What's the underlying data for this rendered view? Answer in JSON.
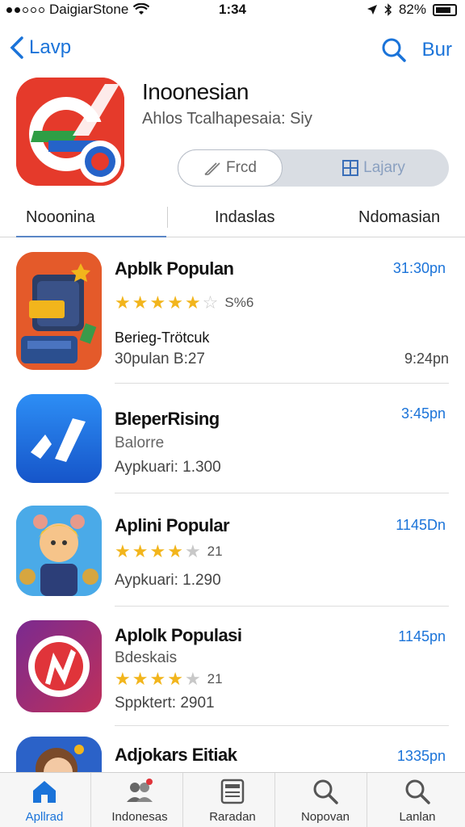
{
  "status": {
    "carrier": "DaigiarStone",
    "time": "1:34",
    "battery": "82%"
  },
  "nav": {
    "back_label": "Lavp",
    "buy_label": "Bur"
  },
  "app": {
    "title": "Inoonesian",
    "subtitle": "Ahlos Tcalhapesaia: Siy",
    "segment": {
      "option1": "Frcd",
      "option2": "Lajary"
    },
    "brand_color": "#e53a2b"
  },
  "tabs": [
    "Nooonina",
    "Indaslas",
    "Ndomasian"
  ],
  "list": [
    {
      "name": "Apblk Populan",
      "time": "31:30pn",
      "rating": 4.5,
      "rating_count": "S%6",
      "line1": "Berieg-Trötcuk",
      "line2": "30pulan B:27",
      "time2": "9:24pn"
    },
    {
      "name": "BleperRising",
      "time": "3:45pn",
      "line1": "Balorre",
      "line2": "Aypkuari: 1.300"
    },
    {
      "name": "Aplini Popular",
      "time": "1145Dn",
      "rating": 4,
      "rating_count": "21",
      "line2": "Aypkuari: 1.290"
    },
    {
      "name": "Aplolk Populasi",
      "time": "1145pn",
      "line1": "Bdeskais",
      "rating": 4,
      "rating_count": "21",
      "line2": "Sppktert: 2901"
    },
    {
      "name": "Adjokars Eitiak",
      "time": "1335pn"
    }
  ],
  "tabbar": [
    "Apllrad",
    "Indonesas",
    "Raradan",
    "Nopovan",
    "Lanlan"
  ],
  "colors": {
    "accent": "#1a73d9",
    "star": "#f2b51c"
  }
}
